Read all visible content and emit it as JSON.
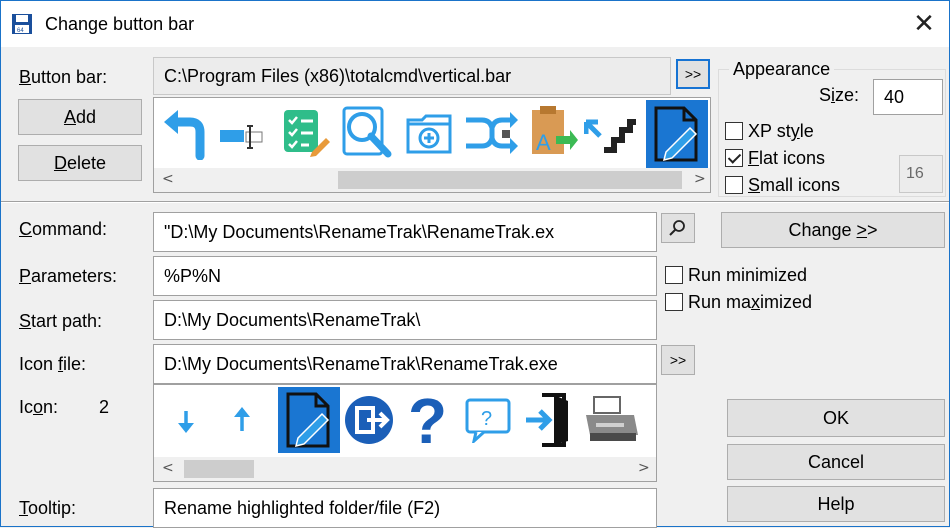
{
  "window": {
    "title": "Change button bar",
    "accent_color": "#1a73c9"
  },
  "buttonbar": {
    "label_pre": "",
    "label_ul": "B",
    "label_post": "utton bar:",
    "path": "C:\\Program Files (x86)\\totalcmd\\vertical.bar",
    "browse_label": ">>",
    "icons": [
      "back-arrow-icon",
      "rename-field-icon",
      "checklist-edit-icon",
      "search-files-icon",
      "new-folder-icon",
      "compare-sync-icon",
      "multi-rename-icon",
      "hotlist-arrows-icon",
      "rename-app-icon"
    ],
    "selected_icon": "rename-app-icon"
  },
  "add_button": {
    "ul": "A",
    "post": "dd"
  },
  "delete_button": {
    "ul": "D",
    "post": "elete"
  },
  "appearance": {
    "title": "Appearance",
    "size_label_pre": "S",
    "size_label_ul": "i",
    "size_label_post": "ze:",
    "size_value": "40",
    "xp_style": {
      "pre": "XP st",
      "ul": "y",
      "post": "le",
      "checked": false
    },
    "flat_icons": {
      "pre": "",
      "ul": "F",
      "post": "lat icons",
      "checked": true
    },
    "small_icons": {
      "pre": "",
      "ul": "S",
      "post": "mall icons",
      "checked": false
    },
    "small_size_value": "16"
  },
  "command": {
    "label_pre": "",
    "label_ul": "C",
    "label_post": "ommand:",
    "value": "\"D:\\My Documents\\RenameTrak\\RenameTrak.ex"
  },
  "change_button": {
    "pre": "Change ",
    "ul": ">",
    "post": ">"
  },
  "parameters": {
    "label_pre": "",
    "label_ul": "P",
    "label_post": "arameters:",
    "value": "%P%N"
  },
  "run_minimized": {
    "pre": "Run minimized",
    "checked": false
  },
  "run_maximized": {
    "pre": "Run ma",
    "ul": "x",
    "post": "imized",
    "checked": false
  },
  "start_path": {
    "label_pre": "",
    "label_ul": "S",
    "label_post": "tart path:",
    "value": "D:\\My Documents\\RenameTrak\\"
  },
  "icon_file": {
    "label_pre": "Icon ",
    "label_ul": "f",
    "label_post": "ile:",
    "value": "D:\\My Documents\\RenameTrak\\RenameTrak.exe",
    "browse_label": ">>"
  },
  "icon": {
    "label_pre": "Ic",
    "label_ul": "o",
    "label_post": "n:",
    "index": "2",
    "icons": [
      "arrow-down-icon",
      "arrow-up-icon",
      "rename-app-icon",
      "exit-circle-icon",
      "question-mark-icon",
      "help-bubble-icon",
      "door-enter-icon",
      "printer-icon"
    ],
    "selected_icon": "rename-app-icon"
  },
  "ok_button": "OK",
  "cancel_button": "Cancel",
  "help_button": "Help",
  "tooltip": {
    "label_pre": "",
    "label_ul": "T",
    "label_post": "ooltip:",
    "value": "Rename highlighted folder/file (F2)"
  }
}
